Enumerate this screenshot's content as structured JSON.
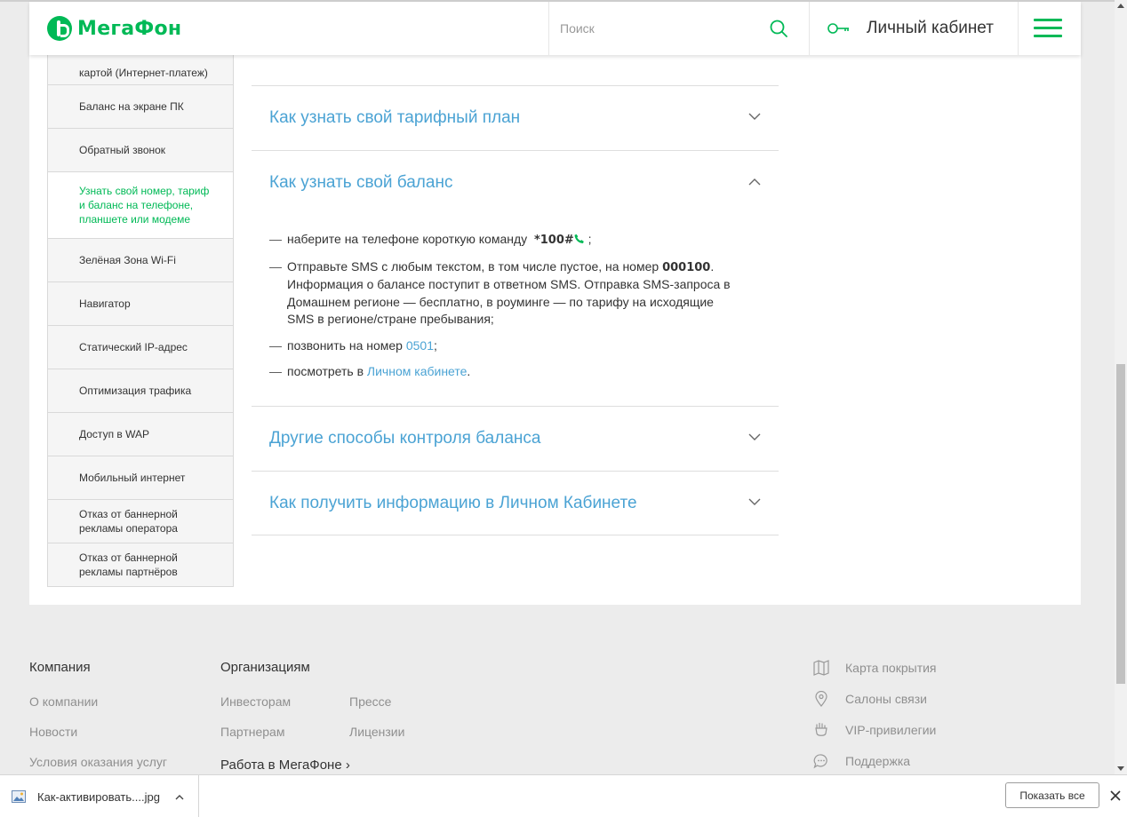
{
  "header": {
    "logo_text": "МегаФон",
    "search_placeholder": "Поиск",
    "cabinet_label": "Личный кабинет"
  },
  "sidebar": {
    "items": [
      {
        "label": "картой (Интернет-платеж)"
      },
      {
        "label": "Баланс на экране ПК"
      },
      {
        "label": "Обратный звонок"
      },
      {
        "label": "Узнать свой номер, тариф и баланс на телефоне, планшете или модеме",
        "active": true
      },
      {
        "label": "Зелёная Зона Wi-Fi"
      },
      {
        "label": "Навигатор"
      },
      {
        "label": "Статический IP-адрес"
      },
      {
        "label": "Оптимизация трафика"
      },
      {
        "label": "Доступ в WAP"
      },
      {
        "label": "Мобильный интернет"
      },
      {
        "label": "Отказ от баннерной рекламы оператора"
      },
      {
        "label": "Отказ от баннерной рекламы партнёров"
      }
    ]
  },
  "accordion": {
    "tariff_title": "Как узнать свой тарифный план",
    "balance_title": "Как узнать свой баланс",
    "balance_items": {
      "item1_text": "наберите на телефоне короткую команду",
      "item1_code": "*100#",
      "item1_end": ";",
      "item2_text": "Отправьте SMS с любым текстом, в том числе пустое, на номер",
      "item2_number": "000100",
      "item2_rest": ". Информация о балансе поступит в ответном SMS. Отправка SMS-запроса в Домашнем регионе — бесплатно, в роуминге — по тарифу на исходящие SMS в регионе/стране пребывания;",
      "item3_text": "позвонить на номер",
      "item3_link": "0501",
      "item3_end": ";",
      "item4_text": "посмотреть в",
      "item4_link": "Личном кабинете",
      "item4_end": "."
    },
    "other_title": "Другие способы контроля баланса",
    "cabinet_title": "Как получить информацию в Личном Кабинете"
  },
  "footer": {
    "company_head": "Компания",
    "company_links": [
      "О компании",
      "Новости",
      "Условия оказания услуг"
    ],
    "org_head": "Организациям",
    "org_links_col1": [
      "Инвесторам",
      "Партнерам"
    ],
    "org_links_col2": [
      "Прессе",
      "Лицензии"
    ],
    "work_label": "Работа в МегаФоне",
    "right_links": [
      {
        "label": "Карта покрытия",
        "icon": "map-icon"
      },
      {
        "label": "Салоны связи",
        "icon": "location-pin-icon"
      },
      {
        "label": "VIP-привилегии",
        "icon": "vip-hand-icon"
      },
      {
        "label": "Поддержка",
        "icon": "chat-bubble-icon"
      }
    ]
  },
  "download_bar": {
    "file_name": "Как-активировать....jpg",
    "show_all_label": "Показать все"
  },
  "colors": {
    "brand_green": "#00b956",
    "link_blue": "#4ba3d4"
  }
}
